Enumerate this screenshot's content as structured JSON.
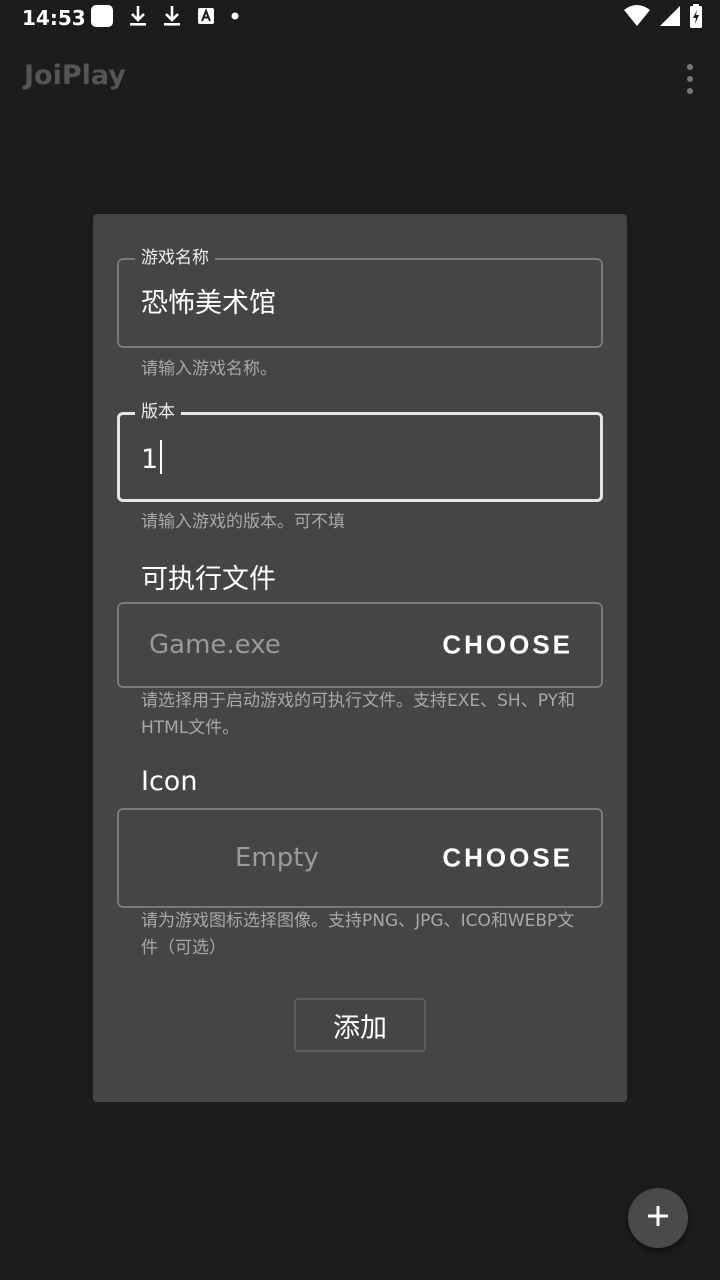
{
  "status_bar": {
    "time": "14:53",
    "left_icons": [
      "app-square-icon",
      "download-icon",
      "download-icon",
      "keyboard-a-icon",
      "dot-icon"
    ],
    "right_icons": [
      "wifi-icon",
      "signal-icon",
      "battery-charging-icon"
    ]
  },
  "app_bar": {
    "title": "JoiPlay",
    "menu_icon": "more-vertical-icon"
  },
  "dialog": {
    "name_field": {
      "label": "游戏名称",
      "value": "恐怖美术馆",
      "helper": "请输入游戏名称。"
    },
    "version_field": {
      "label": "版本",
      "value": "1",
      "helper": "请输入游戏的版本。可不填"
    },
    "executable": {
      "title": "可执行文件",
      "placeholder": "Game.exe",
      "choose_label": "CHOOSE",
      "helper": "请选择用于启动游戏的可执行文件。支持EXE、SH、PY和HTML文件。"
    },
    "icon": {
      "title": "Icon",
      "placeholder": "Empty",
      "choose_label": "CHOOSE",
      "helper": "请为游戏图标选择图像。支持PNG、JPG、ICO和WEBP文件（可选）"
    },
    "add_label": "添加"
  },
  "fab": {
    "icon": "plus-icon"
  },
  "colors": {
    "background": "#1c1c1c",
    "dialog": "#454545",
    "outline": "#7a7a7a",
    "helper_text": "#a8a8a8"
  }
}
